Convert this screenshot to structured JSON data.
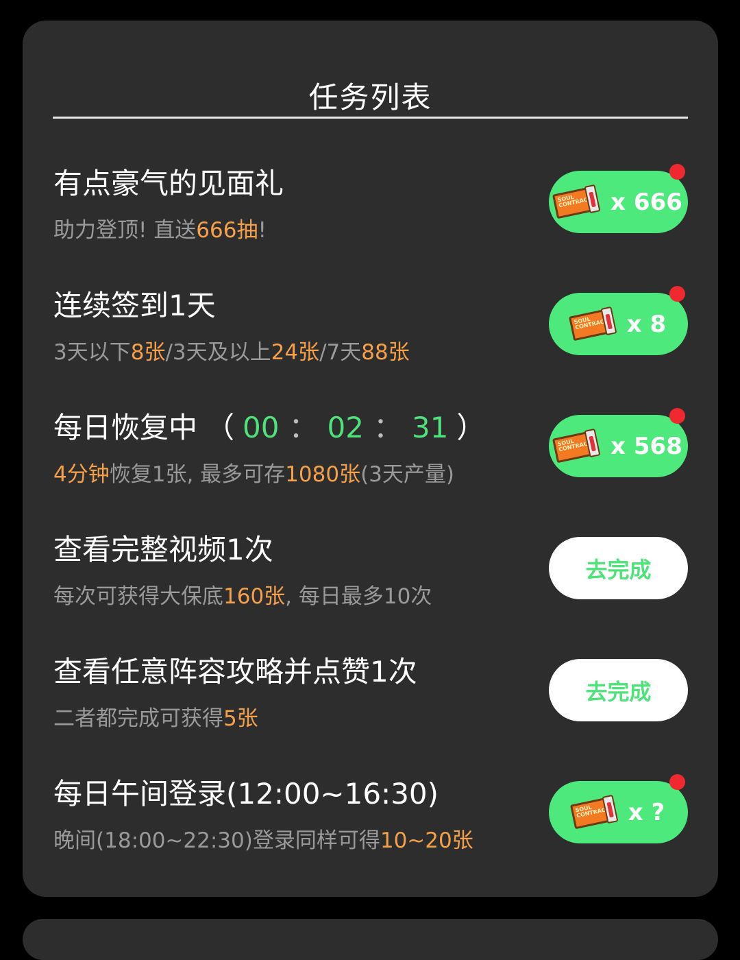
{
  "panel": {
    "title": "任务列表"
  },
  "tasks": [
    {
      "title": "有点豪气的见面礼",
      "desc": {
        "a": "助力登顶! 直送",
        "b": "666抽",
        "c": "!"
      },
      "reward": "x 666"
    },
    {
      "title": "连续签到1天",
      "desc": {
        "a": "3天以下",
        "b": "8张",
        "c": "/3天及以上",
        "d": "24张",
        "e": "/7天",
        "f": "88张"
      },
      "reward": "x 8"
    },
    {
      "title": "每日恢复中",
      "timer": {
        "open": "（",
        "h": "00",
        "sep1": "：",
        "m": "02",
        "sep2": "：",
        "s": "31",
        "close": "）"
      },
      "desc": {
        "a": "4分钟",
        "b": "恢复1张, 最多可存",
        "c": "1080张",
        "d": "(3天产量)"
      },
      "reward": "x 568"
    },
    {
      "title": "查看完整视频1次",
      "desc": {
        "a": "每次可获得大保底",
        "b": "160张",
        "c": ", 每日最多10次"
      },
      "button": "去完成"
    },
    {
      "title": "查看任意阵容攻略并点赞1次",
      "desc": {
        "a": "二者都完成可获得",
        "b": "5张"
      },
      "button": "去完成"
    },
    {
      "title": "每日午间登录(12:00~16:30)",
      "desc": {
        "a": "晚间(18:00~22:30)登录同样可得",
        "b": "10~20张"
      },
      "reward": "x ?"
    }
  ],
  "ticket_icon": {
    "name": "soul-contract-ticket-icon",
    "text": "SOUL CONTRACT"
  },
  "colors": {
    "accent_green": "#4ee97c",
    "highlight_orange": "#f5a04a",
    "notification_red": "#f0282f"
  }
}
